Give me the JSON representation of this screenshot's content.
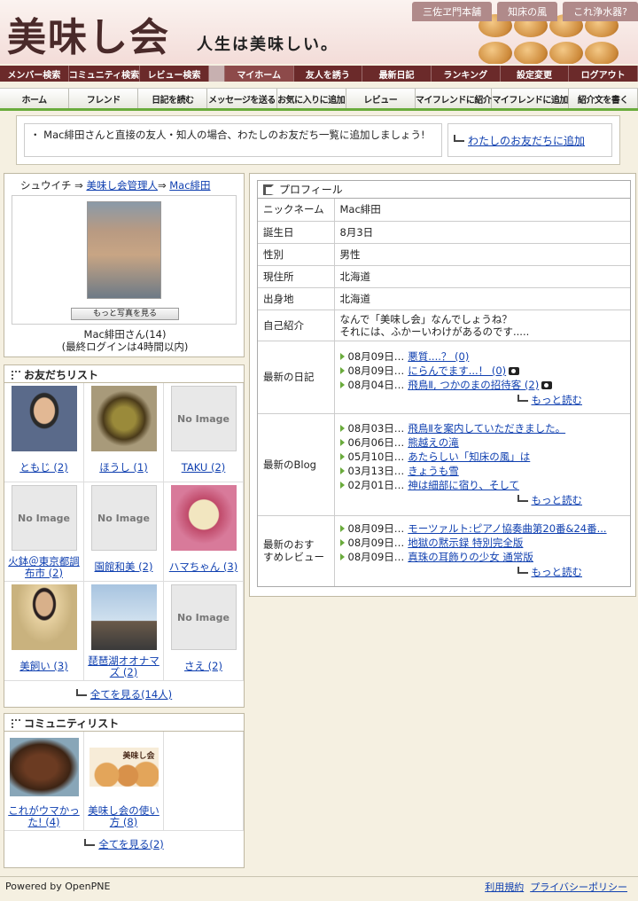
{
  "header": {
    "logo": "美味し会",
    "tagline": "人生は美味しい。",
    "toplinks": [
      "三佐ヱ門本舗",
      "知床の風",
      "これ浄水器?"
    ]
  },
  "nav1": [
    "メンバー検索",
    "コミュニティ検索",
    "レビュー検索",
    "マイホーム",
    "友人を誘う",
    "最新日記",
    "ランキング",
    "設定変更",
    "ログアウト"
  ],
  "nav2": [
    "ホーム",
    "フレンド",
    "日記を読む",
    "メッセージを送る",
    "お気に入りに追加",
    "レビュー",
    "マイフレンドに紹介",
    "マイフレンドに追加",
    "紹介文を書く"
  ],
  "notice": {
    "message": "・ Mac緋田さんと直接の友人・知人の場合、わたしのお友だち一覧に追加しましょう!",
    "add_link": "わたしのお友だちに追加"
  },
  "profile_head": {
    "crumb_start": "シュウイチ ⇒",
    "crumb_mid": "美味し会管理人",
    "crumb_sep": "⇒",
    "crumb_end": "Mac緋田",
    "more_photos": "もっと写真を見る",
    "name_line": "Mac緋田さん(14)",
    "login_line": "(最終ログインは4時間以内)"
  },
  "friends": {
    "title": "お友だちリスト",
    "see_all": "全てを見る(14人)",
    "items": [
      {
        "name": "ともじ (2)",
        "img": "p1"
      },
      {
        "name": "ほうし (1)",
        "img": "p2"
      },
      {
        "name": "TAKU (2)",
        "img": "none"
      },
      {
        "name": "火鉢＠東京都調布市 (2)",
        "img": "none"
      },
      {
        "name": "園館和美 (2)",
        "img": "none"
      },
      {
        "name": "ハマちゃん (3)",
        "img": "p3"
      },
      {
        "name": "美飼い (3)",
        "img": "p4"
      },
      {
        "name": "琵琶湖オオナマズ (2)",
        "img": "p5"
      },
      {
        "name": "さえ (2)",
        "img": "none"
      }
    ]
  },
  "noimage_label": "No Image",
  "communities": {
    "title": "コミュニティリスト",
    "see_all": "全てを見る(2)",
    "items": [
      {
        "name": "これがウマかった! (4)",
        "img": "c1"
      },
      {
        "name": "美味し会の使い方 (8)",
        "img": "c2"
      }
    ],
    "c2_label": "美味し会"
  },
  "profile": {
    "title": "プロフィール",
    "rows": [
      {
        "k": "ニックネーム",
        "v": "Mac緋田"
      },
      {
        "k": "誕生日",
        "v": "8月3日"
      },
      {
        "k": "性別",
        "v": "男性"
      },
      {
        "k": "現住所",
        "v": "北海道"
      },
      {
        "k": "出身地",
        "v": "北海道"
      }
    ],
    "intro_key": "自己紹介",
    "intro_1": "なんで「美味し会」なんでしょうね？",
    "intro_2": "それには、ふかーいわけがあるのです.....",
    "diary_key": "最新の日記",
    "diary": [
      {
        "d": "08月09日…",
        "t": "悪質....？ (0)",
        "cam": false
      },
      {
        "d": "08月09日…",
        "t": "にらんでます...！ (0)",
        "cam": true
      },
      {
        "d": "08月04日…",
        "t": "飛鳥Ⅱ, つかのまの招待客 (2)",
        "cam": true
      }
    ],
    "blog_key": "最新のBlog",
    "blog": [
      {
        "d": "08月03日…",
        "t": "飛鳥Ⅱを案内していただきました。"
      },
      {
        "d": "06月06日…",
        "t": "熊越えの滝"
      },
      {
        "d": "05月10日…",
        "t": "あたらしい「知床の風」は"
      },
      {
        "d": "03月13日…",
        "t": "きょうも雪"
      },
      {
        "d": "02月01日…",
        "t": "神は細部に宿り、そして"
      }
    ],
    "review_key_1": "最新のおす",
    "review_key_2": "すめレビュー",
    "review": [
      {
        "d": "08月09日…",
        "t": "モーツァルト:ピアノ協奏曲第20番&24番..."
      },
      {
        "d": "08月09日…",
        "t": "地獄の黙示録 特別完全版"
      },
      {
        "d": "08月09日…",
        "t": "真珠の耳飾りの少女 通常版"
      }
    ],
    "more": "もっと読む"
  },
  "footer": {
    "powered": "Powered by OpenPNE",
    "terms": "利用規約",
    "privacy": "プライバシーポリシー"
  }
}
